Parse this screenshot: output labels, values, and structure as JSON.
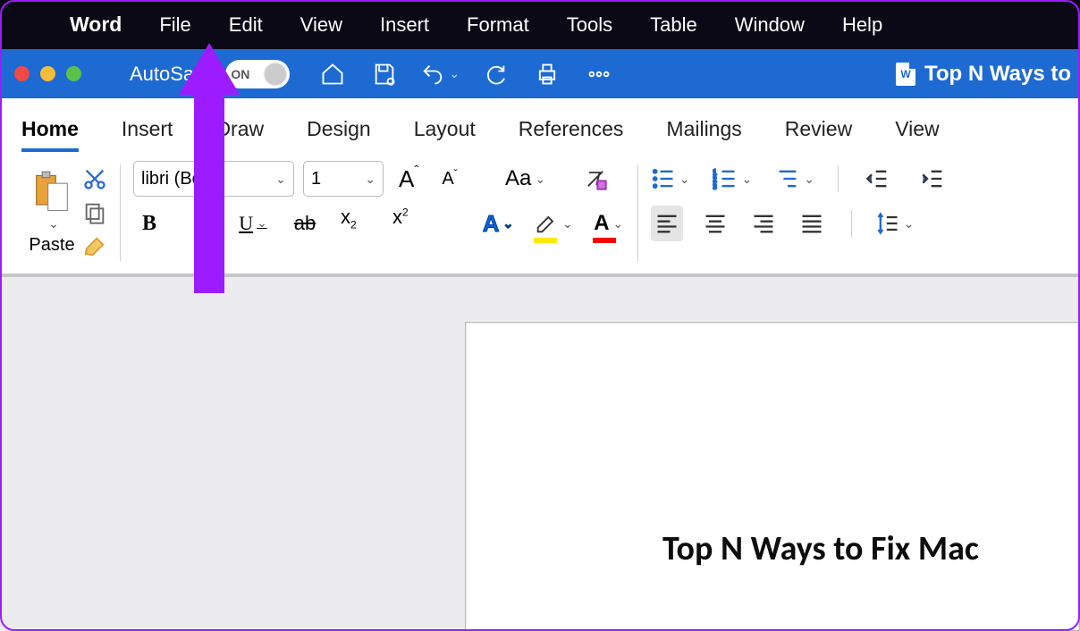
{
  "menubar": {
    "app": "Word",
    "items": [
      "File",
      "Edit",
      "View",
      "Insert",
      "Format",
      "Tools",
      "Table",
      "Window",
      "Help"
    ]
  },
  "titlebar": {
    "autosave_label": "AutoSave",
    "autosave_state": "ON",
    "document_title": "Top N Ways to"
  },
  "ribbon_tabs": [
    "Home",
    "Insert",
    "Draw",
    "Design",
    "Layout",
    "References",
    "Mailings",
    "Review",
    "View"
  ],
  "ribbon_active_tab": "Home",
  "clipboard": {
    "paste_label": "Paste"
  },
  "font": {
    "name": "libri (Bo…",
    "size": "1",
    "case_label": "Aa"
  },
  "document": {
    "heading": "Top N Ways to Fix Mac "
  },
  "colors": {
    "accent": "#1e6ad3",
    "annotation": "#9d1cff",
    "highlight": "#ffe900",
    "fontcolor": "#ff0000"
  }
}
